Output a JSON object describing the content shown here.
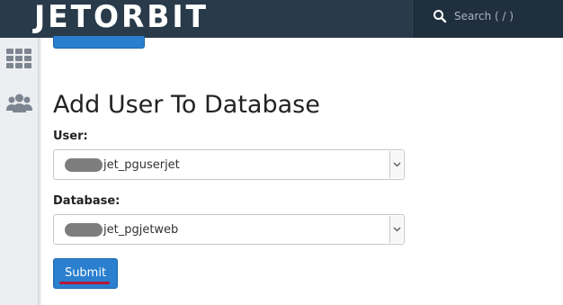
{
  "header": {
    "logo_text": "JETorBIT",
    "search_placeholder": "Search ( / )"
  },
  "sidebar": {
    "items": [
      {
        "icon": "grid-icon"
      },
      {
        "icon": "users-icon"
      }
    ]
  },
  "form": {
    "title": "Add User To Database",
    "user_label": "User:",
    "user_value": "jet_pguserjet",
    "database_label": "Database:",
    "database_value": "jet_pgjetweb",
    "submit_label": "Submit"
  },
  "colors": {
    "topbar": "#293a4a",
    "primary_button": "#2a7fcf",
    "annotation_underline": "#b8153a"
  }
}
